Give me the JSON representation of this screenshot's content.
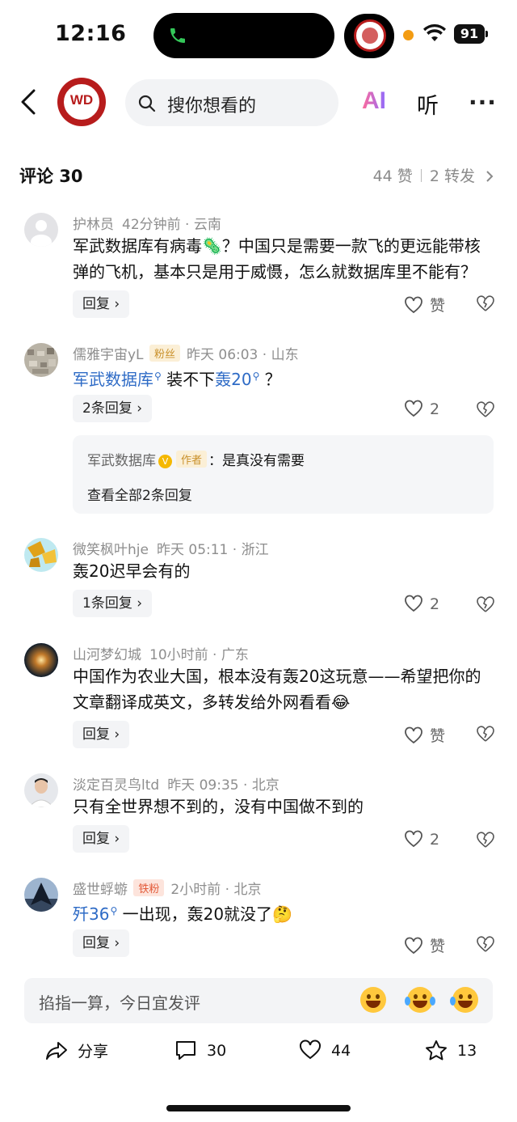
{
  "status": {
    "time": "12:16",
    "battery": "91"
  },
  "header": {
    "logo_text": "WD",
    "search_placeholder": "搜你想看的",
    "ai_label": "AI",
    "listen_label": "听",
    "more_label": "···"
  },
  "comments_header": {
    "title": "评论 30",
    "likes": "44 赞",
    "reposts": "2 转发"
  },
  "comments": [
    {
      "user": "护林员",
      "time": "42分钟前",
      "location": "云南",
      "text_lines": [
        "军武数据库有病毒🦠？中国只是需要一款飞的更远能带核",
        "弹的飞机，基本只是用于威慑，怎么就数据库里不能有？"
      ],
      "reply_label": "回复",
      "likes": "赞"
    },
    {
      "user": "儒雅宇宙yL",
      "badge": "粉丝",
      "time": "昨天 06:03",
      "location": "山东",
      "link1": "军武数据库",
      "mid": " 装不下",
      "link2": "轰20",
      "tail": " ？",
      "reply_label": "2条回复",
      "likes": "2",
      "sub_reply": {
        "user": "军武数据库",
        "v": "V",
        "badge": "作者",
        "text": "：是真没有需要",
        "view_all": "查看全部2条回复"
      }
    },
    {
      "user": "微笑枫叶hje",
      "time": "昨天 05:11",
      "location": "浙江",
      "text": "轰20迟早会有的",
      "reply_label": "1条回复",
      "likes": "2"
    },
    {
      "user": "山河梦幻城",
      "time": "10小时前",
      "location": "广东",
      "text_lines": [
        "中国作为农业大国，根本没有轰20这玩意——希望把你的",
        "文章翻译成英文，多转发给外网看看😂"
      ],
      "reply_label": "回复",
      "likes": "赞"
    },
    {
      "user": "淡定百灵鸟ltd",
      "time": "昨天 09:35",
      "location": "北京",
      "text": "只有全世界想不到的，没有中国做不到的",
      "reply_label": "回复",
      "likes": "2"
    },
    {
      "user": "盛世蜉蝣",
      "badge": "铁粉",
      "time": "2小时前",
      "location": "北京",
      "link1": "歼36",
      "tail": " 一出现，轰20就没了🤔",
      "reply_label": "回复",
      "likes": "赞"
    }
  ],
  "input": {
    "placeholder": "掐指一算，今日宜发评"
  },
  "actions": {
    "share": "分享",
    "comments": "30",
    "likes": "44",
    "favorites": "13"
  },
  "colors": {
    "link": "#2e6bc6",
    "brand": "#b71c1c"
  }
}
